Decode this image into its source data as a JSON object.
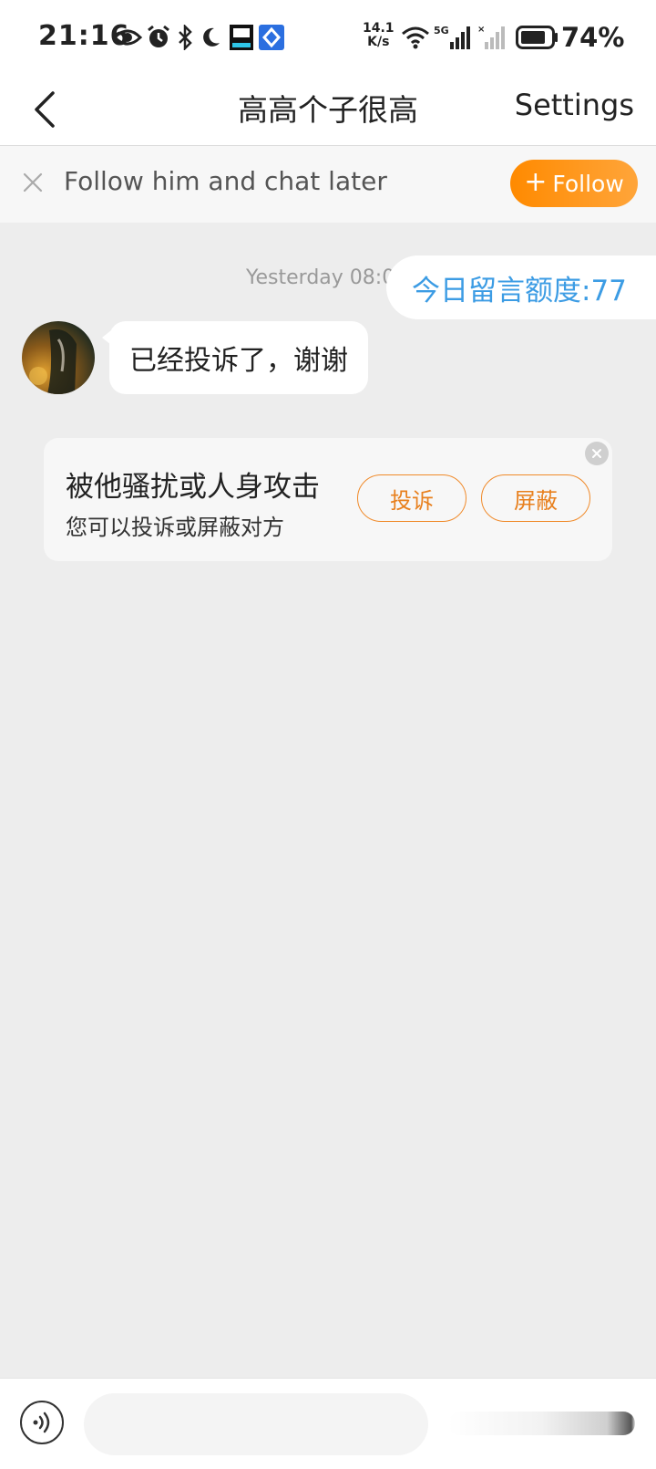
{
  "status_bar": {
    "time": "21:16",
    "net_speed_value": "14.1",
    "net_speed_unit": "K/s",
    "network_type": "5G",
    "battery_percent": "74%",
    "icons": [
      "eye-icon",
      "alarm-icon",
      "bluetooth-icon",
      "moon-icon",
      "app-notification-icon",
      "app-notification-icon-2",
      "wifi-icon",
      "signal-5g-icon",
      "signal-no-service-icon",
      "battery-icon"
    ]
  },
  "header": {
    "title": "高高个子很高",
    "settings_label": "Settings",
    "back_icon": "chevron-left-icon"
  },
  "follow_bar": {
    "text": "Follow him and chat later",
    "button_label": "Follow",
    "button_plus": "+",
    "accent_color": "#ff8a00"
  },
  "chat": {
    "timestamp": "Yesterday 08:0",
    "quota_text": "今日留言额度:77",
    "quota_color": "#3c9ce4",
    "messages": [
      {
        "sender": "other",
        "text": "已经投诉了，谢谢"
      }
    ]
  },
  "safety_card": {
    "title": "被他骚扰或人身攻击",
    "subtitle": "您可以投诉或屏蔽对方",
    "report_label": "投诉",
    "block_label": "屏蔽",
    "button_color": "#f08a2a"
  },
  "input_bar": {
    "placeholder": ""
  }
}
